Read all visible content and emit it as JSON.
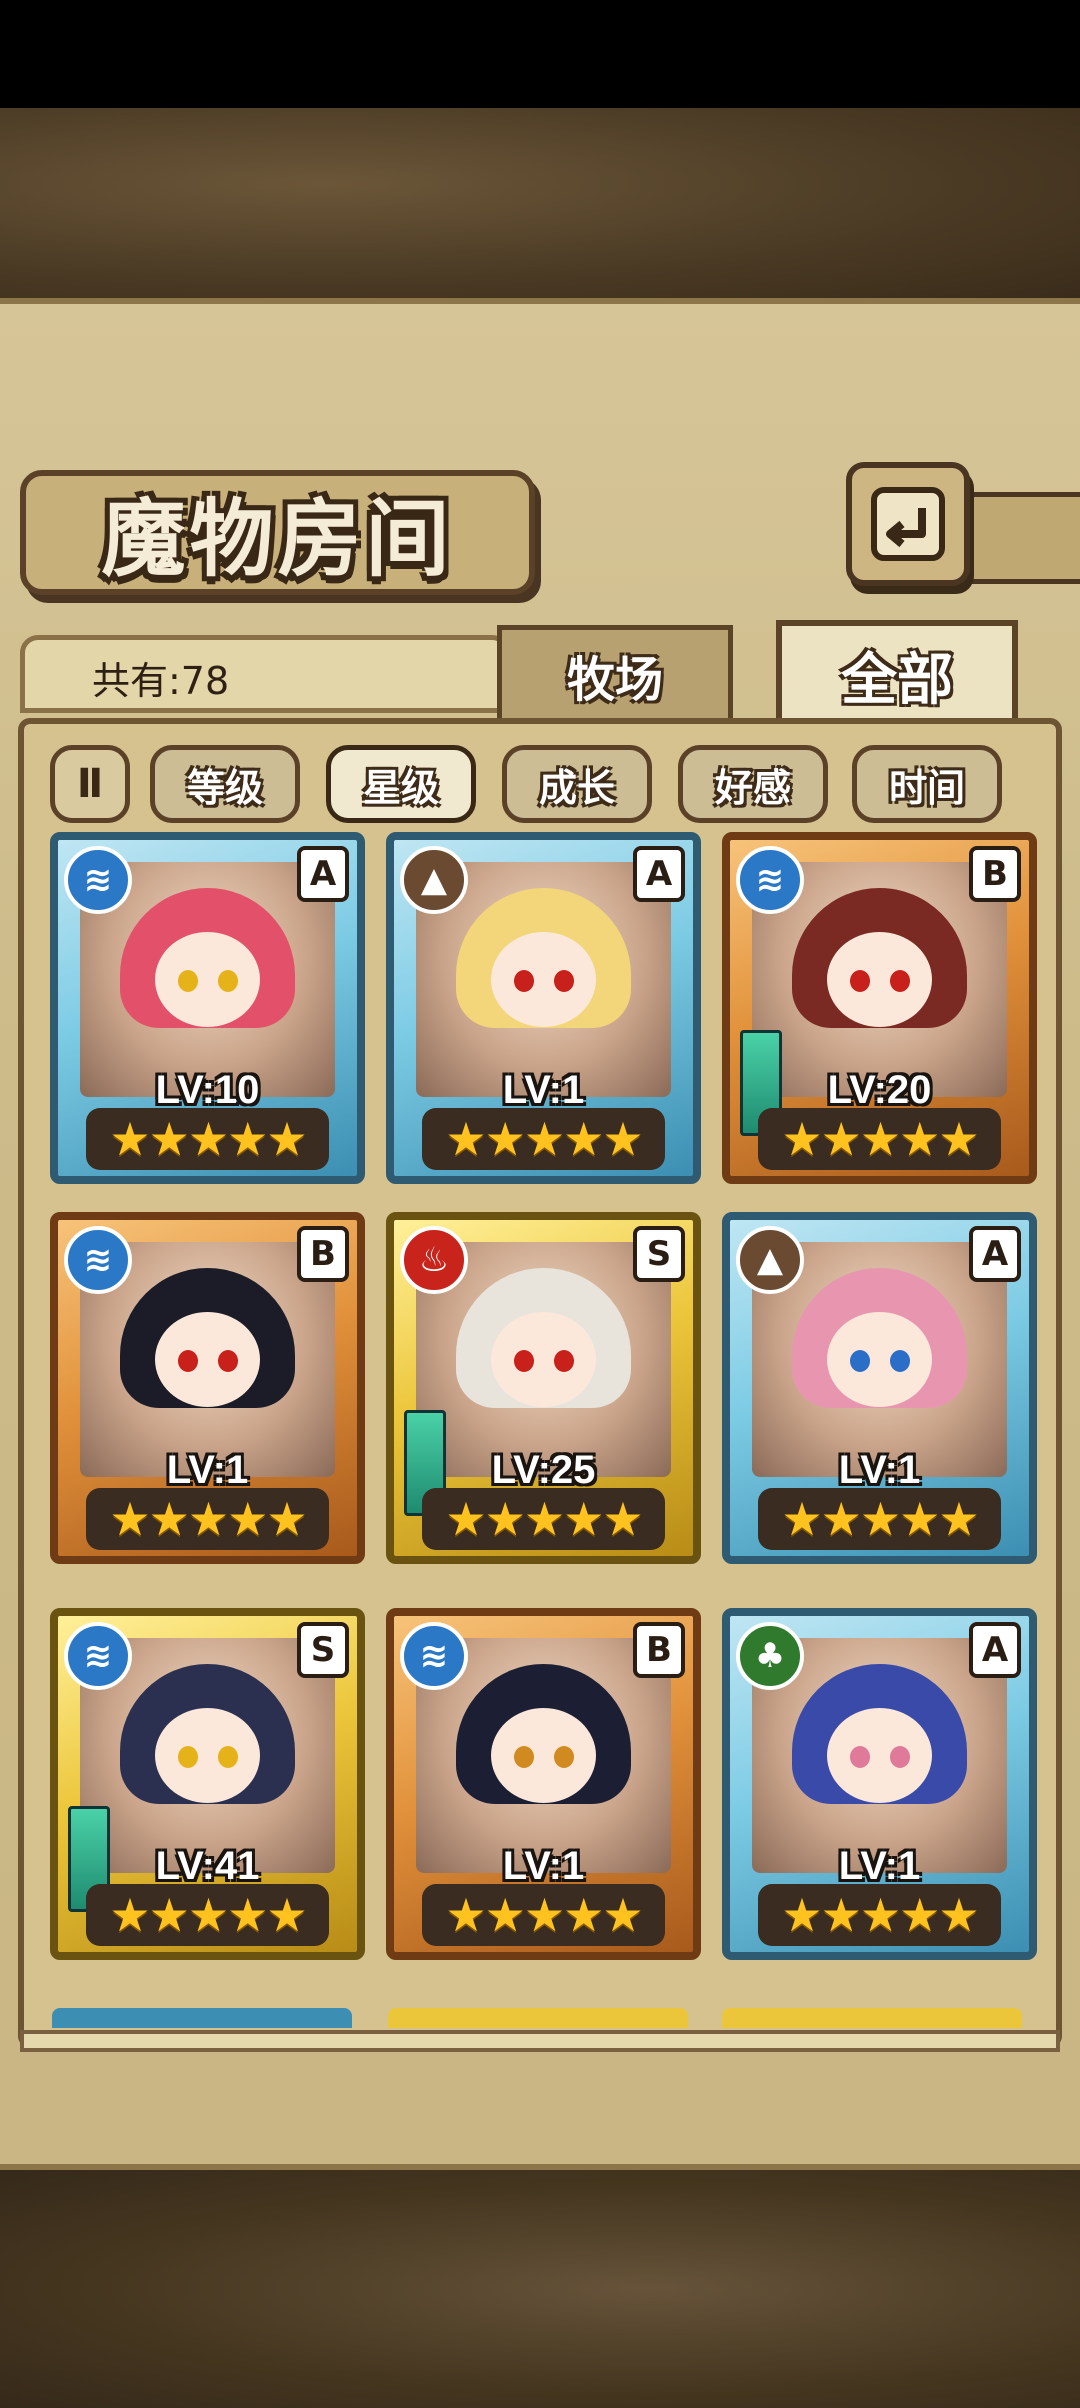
{
  "title": "魔物房间",
  "back_icon": "return-arrow-icon",
  "count_label": "共有:78",
  "tabs": [
    {
      "label": "牧场",
      "active": false
    },
    {
      "label": "全部",
      "active": true
    }
  ],
  "sort_toggle_label": "Ⅱ",
  "filters": [
    {
      "label": "等级",
      "active": false
    },
    {
      "label": "星级",
      "active": true
    },
    {
      "label": "成长",
      "active": false
    },
    {
      "label": "好感",
      "active": false
    },
    {
      "label": "时间",
      "active": false
    }
  ],
  "monsters": [
    {
      "level": "LV:10",
      "rank": "A",
      "element": "water",
      "frame": "blue",
      "stars": "★★★★★",
      "hair": "#e2506a",
      "eyes": "#e6b21a",
      "equipped": false
    },
    {
      "level": "LV:1",
      "rank": "A",
      "element": "earth",
      "frame": "blue",
      "stars": "★★★★★",
      "hair": "#f3d67a",
      "eyes": "#c8201a",
      "equipped": false
    },
    {
      "level": "LV:20",
      "rank": "B",
      "element": "water",
      "frame": "orange",
      "stars": "★★★★★",
      "hair": "#7a2a22",
      "eyes": "#c8201a",
      "equipped": true
    },
    {
      "level": "LV:1",
      "rank": "B",
      "element": "water",
      "frame": "orange",
      "stars": "★★★★★",
      "hair": "#1c1c28",
      "eyes": "#c8201a",
      "equipped": false
    },
    {
      "level": "LV:25",
      "rank": "S",
      "element": "fire",
      "frame": "yellow",
      "stars": "★★★★★",
      "hair": "#e8e4dc",
      "eyes": "#c8201a",
      "equipped": true
    },
    {
      "level": "LV:1",
      "rank": "A",
      "element": "earth",
      "frame": "blue",
      "stars": "★★★★★",
      "hair": "#e896b0",
      "eyes": "#2a6ec8",
      "equipped": false
    },
    {
      "level": "LV:41",
      "rank": "S",
      "element": "water",
      "frame": "yellow",
      "stars": "★★★★★",
      "hair": "#2c3050",
      "eyes": "#e6b21a",
      "equipped": true
    },
    {
      "level": "LV:1",
      "rank": "B",
      "element": "water",
      "frame": "orange",
      "stars": "★★★★★",
      "hair": "#1c1e34",
      "eyes": "#d08a20",
      "equipped": false
    },
    {
      "level": "LV:1",
      "rank": "A",
      "element": "wood",
      "frame": "blue",
      "stars": "★★★★★",
      "hair": "#3a4aa8",
      "eyes": "#e07a9a",
      "equipped": false
    }
  ],
  "element_glyphs": {
    "water": "≋",
    "earth": "▲",
    "fire": "♨",
    "wood": "♣"
  }
}
